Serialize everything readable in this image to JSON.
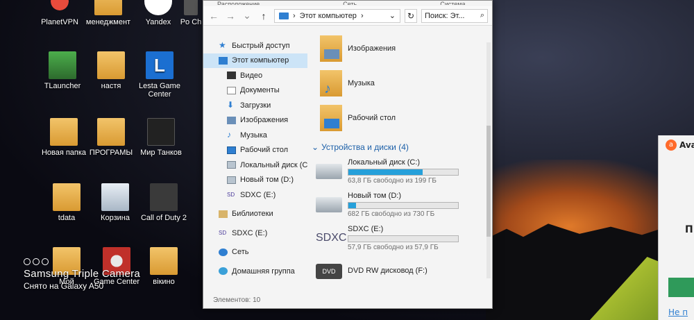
{
  "desktop": {
    "icons": [
      {
        "label": "PlanetVPN",
        "icon": "planetvpn-icon"
      },
      {
        "label": "менеджмент",
        "icon": "folder-icon"
      },
      {
        "label": "Yandex",
        "icon": "yandex-icon"
      },
      {
        "label": "Po Ch",
        "icon": "partial-icon"
      },
      {
        "label": "TLauncher",
        "icon": "tlauncher-icon"
      },
      {
        "label": "настя",
        "icon": "folder-icon"
      },
      {
        "label": "Lesta Game Center",
        "icon": "lesta-icon"
      },
      {
        "label": "Новая папка",
        "icon": "folder-icon"
      },
      {
        "label": "ПРОГРАМЫ",
        "icon": "folder-icon"
      },
      {
        "label": "Мир Танков",
        "icon": "tanks-icon"
      },
      {
        "label": "tdata",
        "icon": "folder-icon"
      },
      {
        "label": "Корзина",
        "icon": "recycle-bin-icon"
      },
      {
        "label": "Call of Duty 2",
        "icon": "cod2-icon"
      },
      {
        "label": "Мой",
        "icon": "folder-icon"
      },
      {
        "label": "Game Center",
        "icon": "wot-icon"
      },
      {
        "label": "вікино",
        "icon": "folder-icon"
      }
    ]
  },
  "explorer": {
    "menu": [
      "Расположение",
      "Сеть",
      "Система"
    ],
    "address": "Этот компьютер",
    "address_arrow": "›",
    "search_placeholder": "Поиск: Эт...",
    "nav_items": [
      {
        "label": "Быстрый доступ",
        "icon": "star-icon"
      },
      {
        "label": "Этот компьютер",
        "icon": "pc-icon"
      },
      {
        "label": "Видео",
        "icon": "video-icon"
      },
      {
        "label": "Документы",
        "icon": "documents-icon"
      },
      {
        "label": "Загрузки",
        "icon": "downloads-icon"
      },
      {
        "label": "Изображения",
        "icon": "pictures-icon"
      },
      {
        "label": "Музыка",
        "icon": "music-icon"
      },
      {
        "label": "Рабочий стол",
        "icon": "desktop-icon"
      },
      {
        "label": "Локальный диск (С",
        "icon": "disk-icon"
      },
      {
        "label": "Новый том (D:)",
        "icon": "disk-icon"
      },
      {
        "label": "SDXC (E:)",
        "icon": "sdxc-icon"
      },
      {
        "label": "Библиотеки",
        "icon": "libraries-icon"
      },
      {
        "label": "SDXC (E:)",
        "icon": "sdxc-icon"
      },
      {
        "label": "Сеть",
        "icon": "network-icon"
      },
      {
        "label": "Домашняя группа",
        "icon": "homegroup-icon"
      }
    ],
    "folders": [
      {
        "label": "Изображения",
        "icon": "pictures-folder-icon"
      },
      {
        "label": "Музыка",
        "icon": "music-folder-icon"
      },
      {
        "label": "Рабочий стол",
        "icon": "desktop-folder-icon"
      }
    ],
    "devices_header": "Устройства и диски (4)",
    "drives": [
      {
        "name": "Локальный диск (C:)",
        "free": "63,8 ГБ свободно из 199 ГБ",
        "used_fraction": 0.68,
        "icon": "windows-drive-icon"
      },
      {
        "name": "Новый том (D:)",
        "free": "682 ГБ свободно из 730 ГБ",
        "used_fraction": 0.07,
        "icon": "hdd-icon"
      },
      {
        "name": "SDXC (E:)",
        "free": "57,9 ГБ свободно из 57,9 ГБ",
        "used_fraction": 0.0,
        "icon": "sdxc-drive-icon"
      },
      {
        "name": "DVD RW дисковод (F:)",
        "free": "",
        "icon": "dvd-icon"
      }
    ],
    "status": "Элементов: 10",
    "colors": {
      "selected": "#cce4f7",
      "bar": "#26a0da",
      "group_header": "#1b5fa8"
    }
  },
  "avast": {
    "title": "Ava",
    "letter": "П",
    "link": "Не п"
  },
  "watermark": {
    "title": "Samsung Triple Camera",
    "subtitle": "Снято на Galaxy A50"
  }
}
